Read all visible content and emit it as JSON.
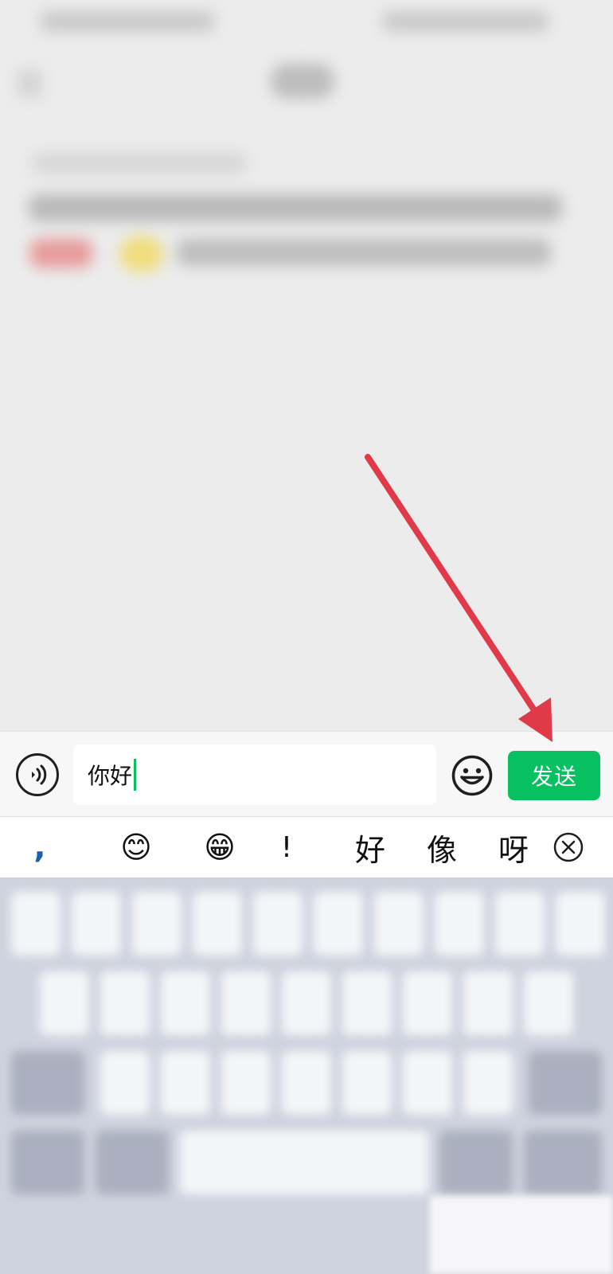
{
  "input": {
    "text": "你好"
  },
  "send_button": {
    "label": "发送"
  },
  "candidates": {
    "comma": ",",
    "emoji_smile": "😊",
    "emoji_grin": "😁",
    "exclaim": "!",
    "word1": "好",
    "word2": "像",
    "word3": "呀"
  },
  "icons": {
    "voice": "voice-icon",
    "emoji": "emoji-icon",
    "delete": "clear-icon"
  },
  "colors": {
    "accent_green": "#07c160",
    "arrow_red": "#e03a48"
  }
}
